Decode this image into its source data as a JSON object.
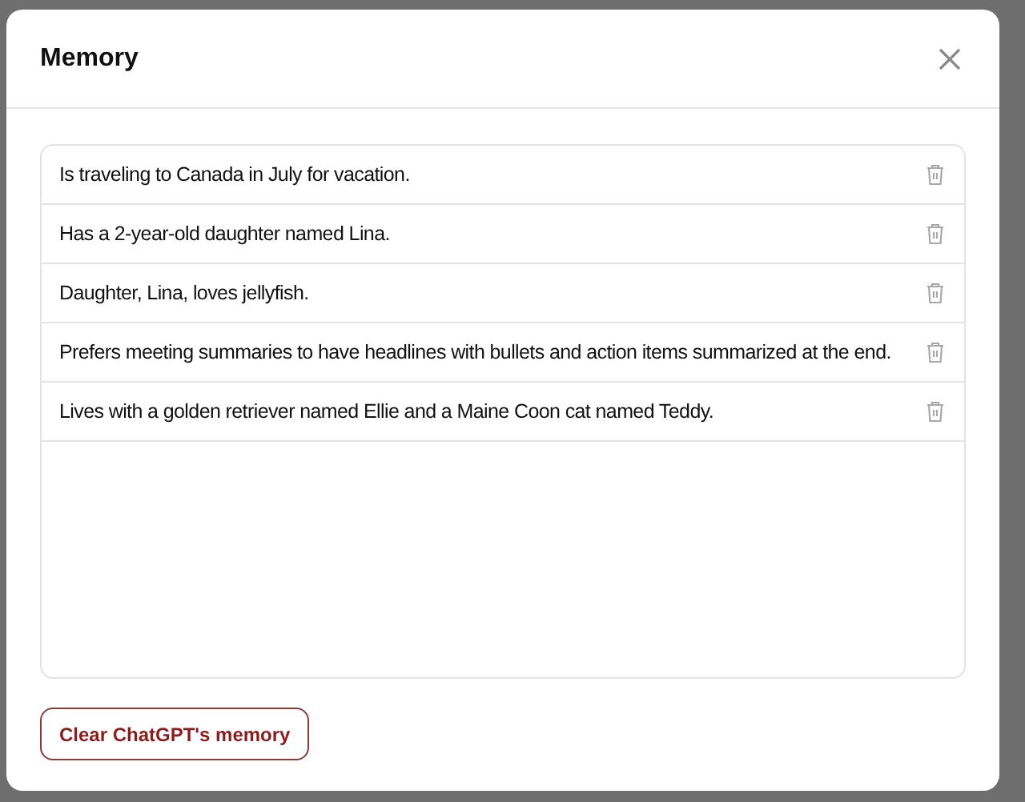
{
  "dialog": {
    "title": "Memory",
    "memories": [
      {
        "text": "Is traveling to Canada in July for vacation."
      },
      {
        "text": "Has a 2-year-old daughter named Lina."
      },
      {
        "text": "Daughter, Lina, loves jellyfish."
      },
      {
        "text": "Prefers meeting summaries to have headlines with bullets and action items summarized at the end."
      },
      {
        "text": "Lives with a golden retriever named Ellie and a Maine Coon cat named Teddy."
      }
    ],
    "clear_button": "Clear ChatGPT's memory"
  }
}
